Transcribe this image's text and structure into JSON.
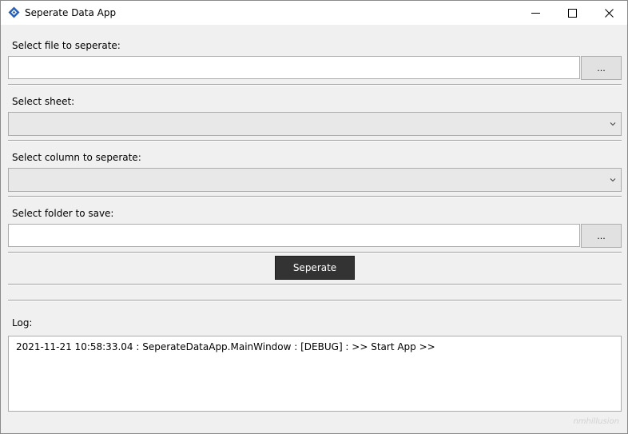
{
  "window": {
    "title": "Seperate Data App",
    "icons": {
      "app": "diamond-app-icon",
      "minimize": "minimize-icon",
      "maximize": "maximize-icon",
      "close": "close-icon"
    }
  },
  "file_section": {
    "label": "Select file to seperate:",
    "value": "",
    "browse_label": "..."
  },
  "sheet_section": {
    "label": "Select sheet:",
    "selected": ""
  },
  "column_section": {
    "label": "Select column to seperate:",
    "selected": ""
  },
  "folder_section": {
    "label": "Select folder to save:",
    "value": "",
    "browse_label": "..."
  },
  "actions": {
    "run_label": "Seperate"
  },
  "log": {
    "label": "Log:",
    "lines": [
      "2021-11-21 10:58:33.04 : SeperateDataApp.MainWindow : [DEBUG] : >> Start App >>"
    ]
  },
  "watermark": "nmhillusion",
  "colors": {
    "accent": "#2b5fb4",
    "button_dark": "#333333"
  }
}
